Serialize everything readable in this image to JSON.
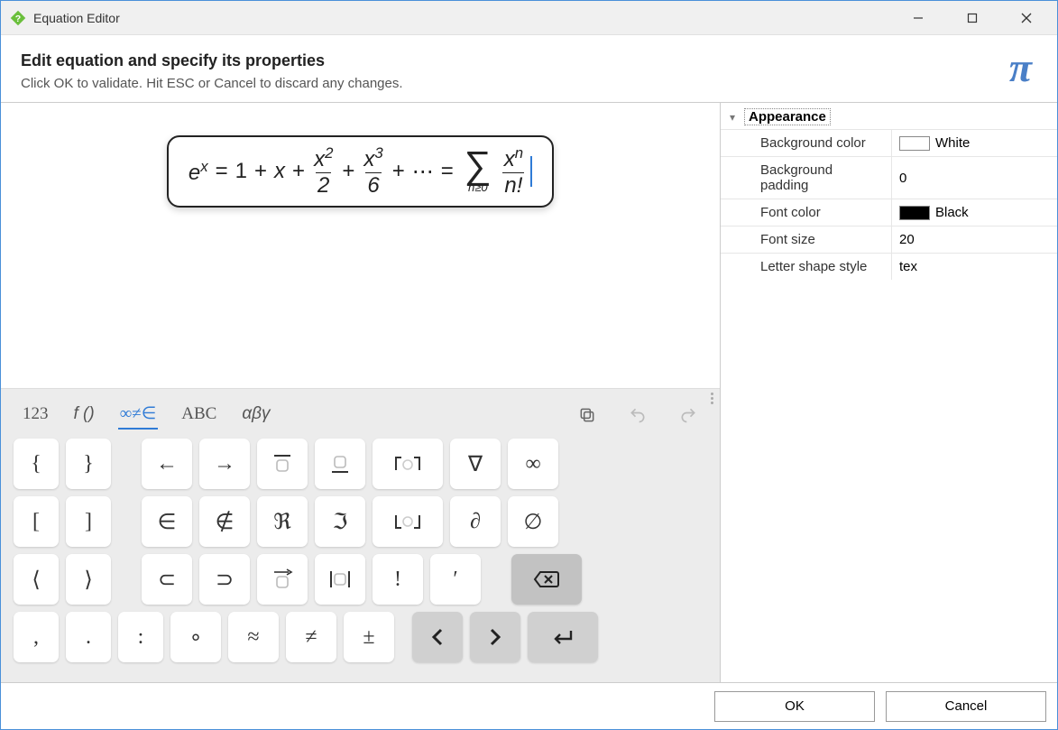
{
  "window": {
    "title": "Equation Editor"
  },
  "header": {
    "heading": "Edit equation and specify its properties",
    "subheading": "Click OK to validate. Hit ESC or Cancel to discard any changes.",
    "pi_icon": "π"
  },
  "equation": {
    "latex": "e^{x} = 1 + x + \\frac{x^{2}}{2} + \\frac{x^{3}}{6} + \\cdots = \\sum_{n \\ge 0} \\frac{x^{n}}{n!}",
    "parts": {
      "e": "e",
      "x": "x",
      "eq": "=",
      "one": "1",
      "plus": "+",
      "x2_num": "x",
      "x2_pow": "2",
      "x2_den": "2",
      "x3_num": "x",
      "x3_pow": "3",
      "x3_den": "6",
      "dots": "⋯",
      "sum": "∑",
      "sum_sub": "n≥0",
      "xn_num": "x",
      "xn_pow": "n",
      "xn_den": "n!"
    }
  },
  "keyboard": {
    "tabs": {
      "numbers": "123",
      "func": "f ()",
      "symbols": "∞≠∈",
      "latin": "ABC",
      "greek": "αβγ"
    },
    "active_tab": "symbols",
    "rows": [
      [
        "{",
        "}",
        "",
        "←",
        "→",
        "▭̄",
        "▭̲",
        "⌈○⌉",
        "∇",
        "∞"
      ],
      [
        "[",
        "]",
        "",
        "∈",
        "∉",
        "ℜ",
        "ℑ",
        "⌊○⌋",
        "∂",
        "∅"
      ],
      [
        "⟨",
        "⟩",
        "",
        "⊂",
        "⊃",
        "▭⃗",
        "|▭|",
        "!",
        "′",
        "",
        "⌫"
      ],
      [
        ",",
        ".",
        ":",
        "∘",
        "≈",
        "≠",
        "±",
        "",
        "‹",
        "›",
        "↵"
      ]
    ]
  },
  "properties": {
    "section_title": "Appearance",
    "rows": [
      {
        "label": "Background color",
        "value": "White",
        "swatch": "white"
      },
      {
        "label": "Background padding",
        "value": "0"
      },
      {
        "label": "Font color",
        "value": "Black",
        "swatch": "black"
      },
      {
        "label": "Font size",
        "value": "20"
      },
      {
        "label": "Letter shape style",
        "value": "tex"
      }
    ]
  },
  "footer": {
    "ok": "OK",
    "cancel": "Cancel"
  }
}
